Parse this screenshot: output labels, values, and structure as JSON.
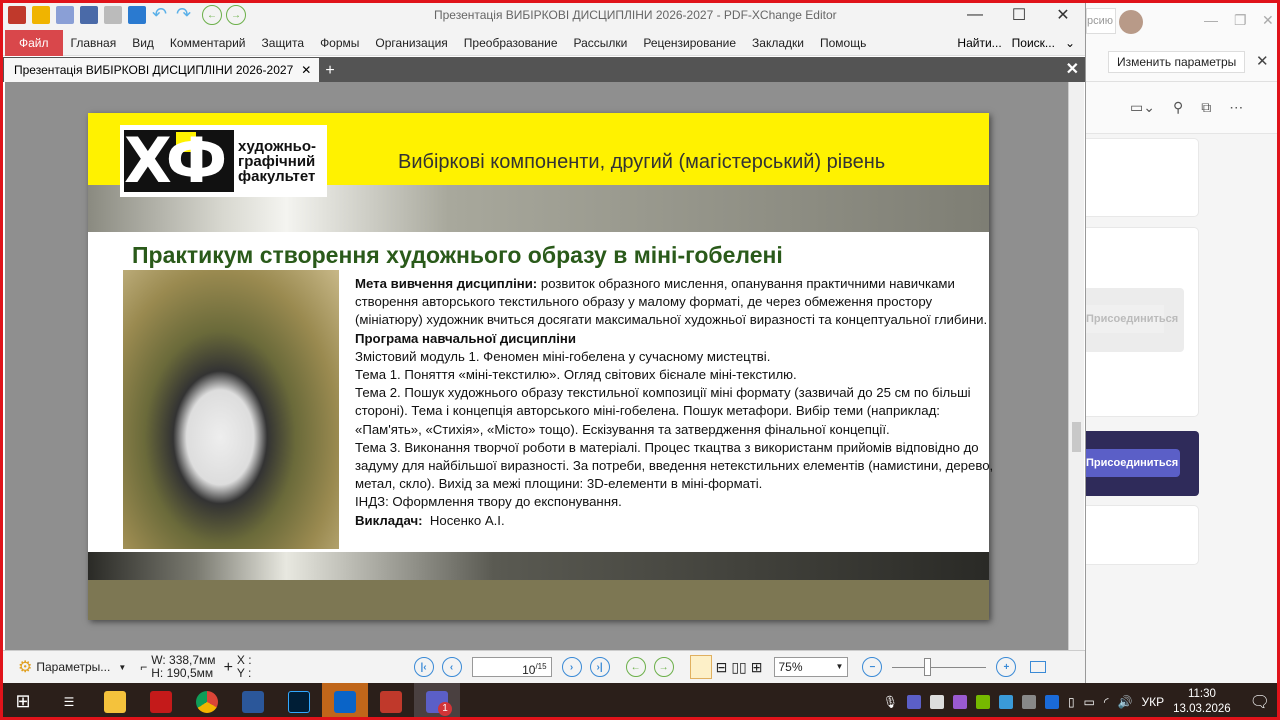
{
  "app": {
    "title": "Презентація ВИБІРКОВІ ДИСЦИПЛІНИ 2026-2027 - PDF-XChange Editor"
  },
  "menu": {
    "items": [
      "Файл",
      "Главная",
      "Вид",
      "Комментарий",
      "Защита",
      "Формы",
      "Организация",
      "Преобразование",
      "Рассылки",
      "Рецензирование",
      "Закладки",
      "Помощь"
    ],
    "find": "Найти...",
    "search": "Поиск..."
  },
  "tab": {
    "label": "Презентація ВИБІРКОВІ ДИСЦИПЛІНИ 2026-2027"
  },
  "slide": {
    "logo_text": [
      "художньо-",
      "графічний",
      "факультет"
    ],
    "logo_mark": "ХГФ",
    "header": "Вибіркові компоненти, другий (магістерський) рівень",
    "title": "Практикум створення художнього образу в міні-гобелені",
    "goal_label": "Мета вивчення дисципліни:",
    "goal_text": " розвиток образного мислення, опанування практичними навичками створення авторського текстильного образу у малому форматі, де через обмеження простору (мініатюру) художник вчиться досягати максимальної художньої виразності та концептуальної глибини.",
    "program_label": "Програма навчальної дисципліни",
    "lines": [
      "Змістовий модуль 1. Феномен міні-гобелена у сучасному мистецтві.",
      "Тема 1. Поняття «міні-текстилю». Огляд світових бієнале міні-текстилю.",
      "Тема 2. Пошук художнього образу текстильної композиції міні формату (зазвичай до 25 см по більші стороні). Тема і концепція авторського міні-гобелена. Пошук метафори. Вибір теми (наприклад: «Пам'ять», «Стихія», «Місто» тощо). Ескізування та затвердження фінальної концепції.",
      "Тема 3. Виконання творчої роботи в матеріалі. Процес ткацтва з використанм прийомів відповідно до задуму для найбільшої виразності. За потреби, введення нетекстильних елементів (намистини, дерево, метал, скло). Вихід за межі площини: 3D-елементи в міні-форматі.",
      "ІНДЗ: Оформлення твору до експонування."
    ],
    "teacher_label": "Викладач:",
    "teacher_name": "  Носенко А.І."
  },
  "status": {
    "params": "Параметры...",
    "width": "W: 338,7мм",
    "height": "H: 190,5мм",
    "x": "X :",
    "y": "Y :",
    "page": "10",
    "pages": "/15",
    "zoom": "75%",
    "zoom_slider_fraction": 0.35
  },
  "teams": {
    "partial_pill": "рсию",
    "change_params": "Изменить параметры",
    "join_disabled": "Присоединиться",
    "join": "Присоединиться"
  },
  "taskbar": {
    "lang": "УКР",
    "time": "11:30",
    "date": "13.03.2026",
    "teams_badge": "1"
  },
  "colors": {
    "accent_red": "#d9474b",
    "slide_yellow": "#fff200",
    "title_green": "#2a5a1a",
    "teams_purple": "#5b5fc7"
  }
}
